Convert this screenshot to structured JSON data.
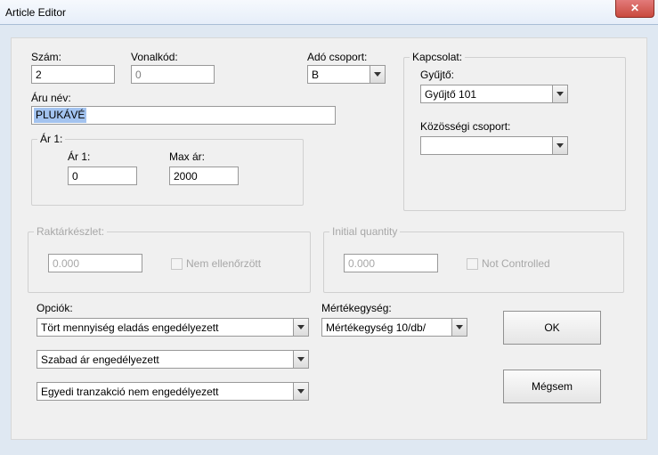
{
  "window": {
    "title": "Article Editor"
  },
  "labels": {
    "szam": "Szám:",
    "vonalkod": "Vonalkód:",
    "ado_csoport": "Adó csoport:",
    "aru_nev": "Áru név:",
    "ar1_group": "Ár 1:",
    "ar1_inner": "Ár 1:",
    "max_ar": "Max ár:",
    "kapcsolat_group": "Kapcsolat:",
    "gyujto": "Gyűjtő:",
    "kozossegi": "Közösségi csoport:",
    "raktarkeszlet_group": "Raktárkészlet:",
    "nem_ellenorzott": "Nem ellenőrzött",
    "initial_qty_group": "Initial quantity",
    "not_controlled": "Not Controlled",
    "opciok": "Opciók:",
    "mertekegyseg": "Mértékegység:"
  },
  "values": {
    "szam": "2",
    "vonalkod": "0",
    "ado_csoport": "B",
    "aru_nev": "PLUKÁVÉ",
    "ar1": "0",
    "max_ar": "2000",
    "gyujto": "Gyűjtő 101",
    "kozossegi": "",
    "raktarkeszlet": "0.000",
    "initial_qty": "0.000",
    "opcio1": "Tört mennyiség eladás engedélyezett",
    "opcio2": "Szabad ár engedélyezett",
    "opcio3": "Egyedi tranzakció nem engedélyezett",
    "mertekegyseg_sel": "Mértékegység 10/db/"
  },
  "buttons": {
    "ok": "OK",
    "cancel": "Mégsem"
  }
}
